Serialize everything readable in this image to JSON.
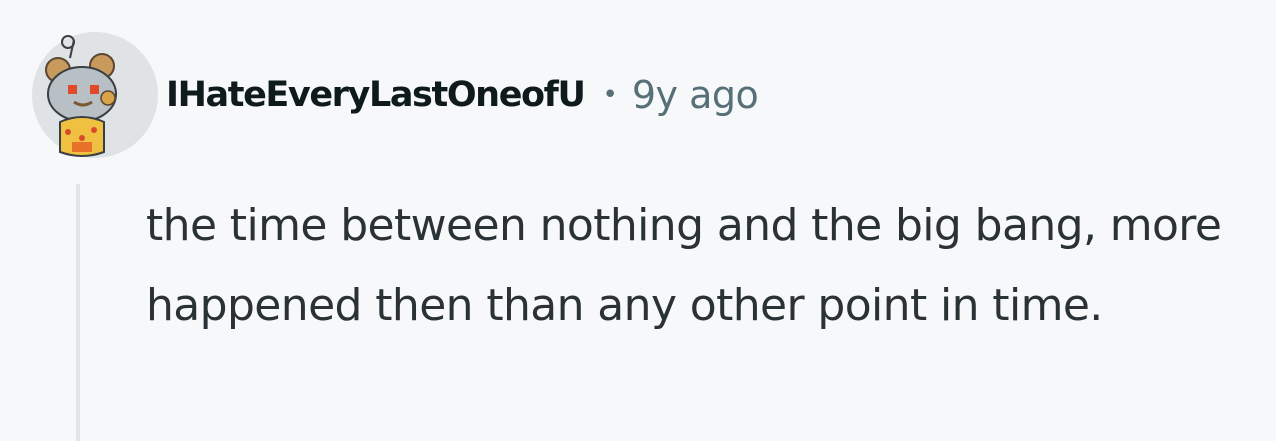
{
  "comment": {
    "author": "IHateEveryLastOneofU",
    "separator": "•",
    "timestamp": "9y ago",
    "avatar_icon": "reddit-snoo-avatar-icon",
    "body": "the time between nothing and the big bang, more happened then than any other point in time."
  },
  "colors": {
    "background": "#f6f8f9",
    "author": "#0f1a1c",
    "meta": "#576f76",
    "body": "#2a3236",
    "thread_line": "#dfe5e8"
  }
}
